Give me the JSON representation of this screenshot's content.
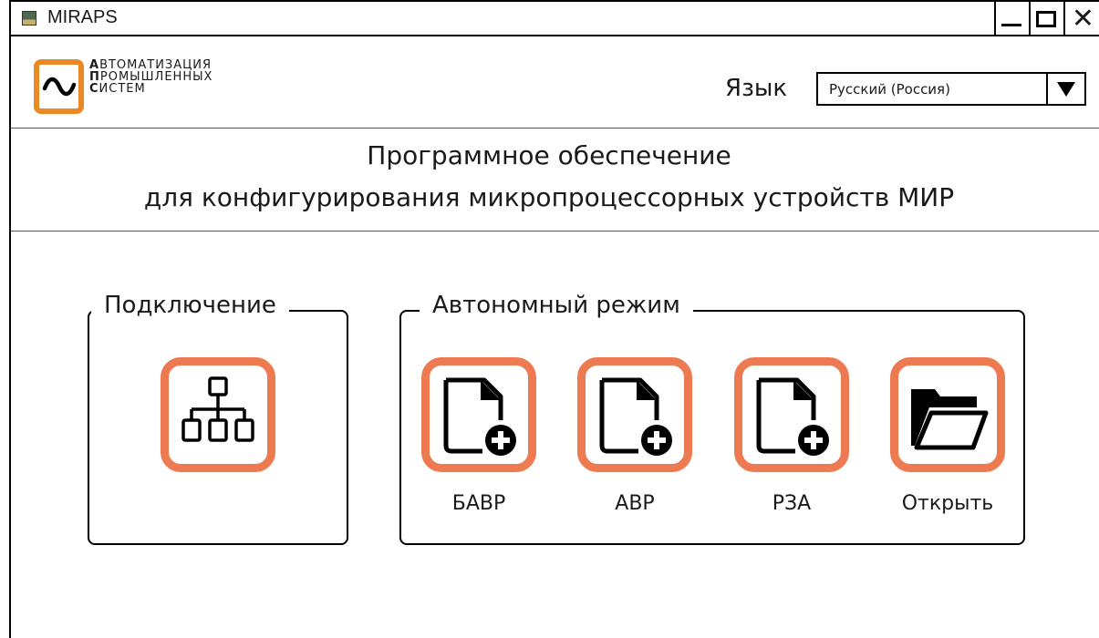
{
  "window": {
    "title": "MIRAPS",
    "controls": {
      "minimize_icon": "minimize-icon",
      "maximize_icon": "maximize-icon",
      "close_icon": "close-icon"
    }
  },
  "header": {
    "logo": {
      "lines": [
        {
          "cap": "А",
          "rest": "ВТОМАТИЗАЦИЯ"
        },
        {
          "cap": "П",
          "rest": "РОМЫШЛЕННЫХ"
        },
        {
          "cap": "С",
          "rest": "ИСТЕМ"
        }
      ],
      "accent": "#ea8a26"
    },
    "language_label": "Язык",
    "language_value": "Русский (Россия)"
  },
  "subtitle": {
    "line1": "Программное обеспечение",
    "line2": "для конфигурирования микропроцессорных устройств МИР"
  },
  "connection": {
    "legend": "Подключение",
    "icon": "network-icon"
  },
  "offline": {
    "legend": "Автономный режим",
    "items": [
      {
        "label": "БАВР",
        "icon": "new-file-icon"
      },
      {
        "label": "АВР",
        "icon": "new-file-icon"
      },
      {
        "label": "РЗА",
        "icon": "new-file-icon"
      },
      {
        "label": "Открыть",
        "icon": "folder-open-icon"
      }
    ]
  },
  "colors": {
    "tile_border": "#ee7a52",
    "logo_border": "#ea8a26"
  }
}
